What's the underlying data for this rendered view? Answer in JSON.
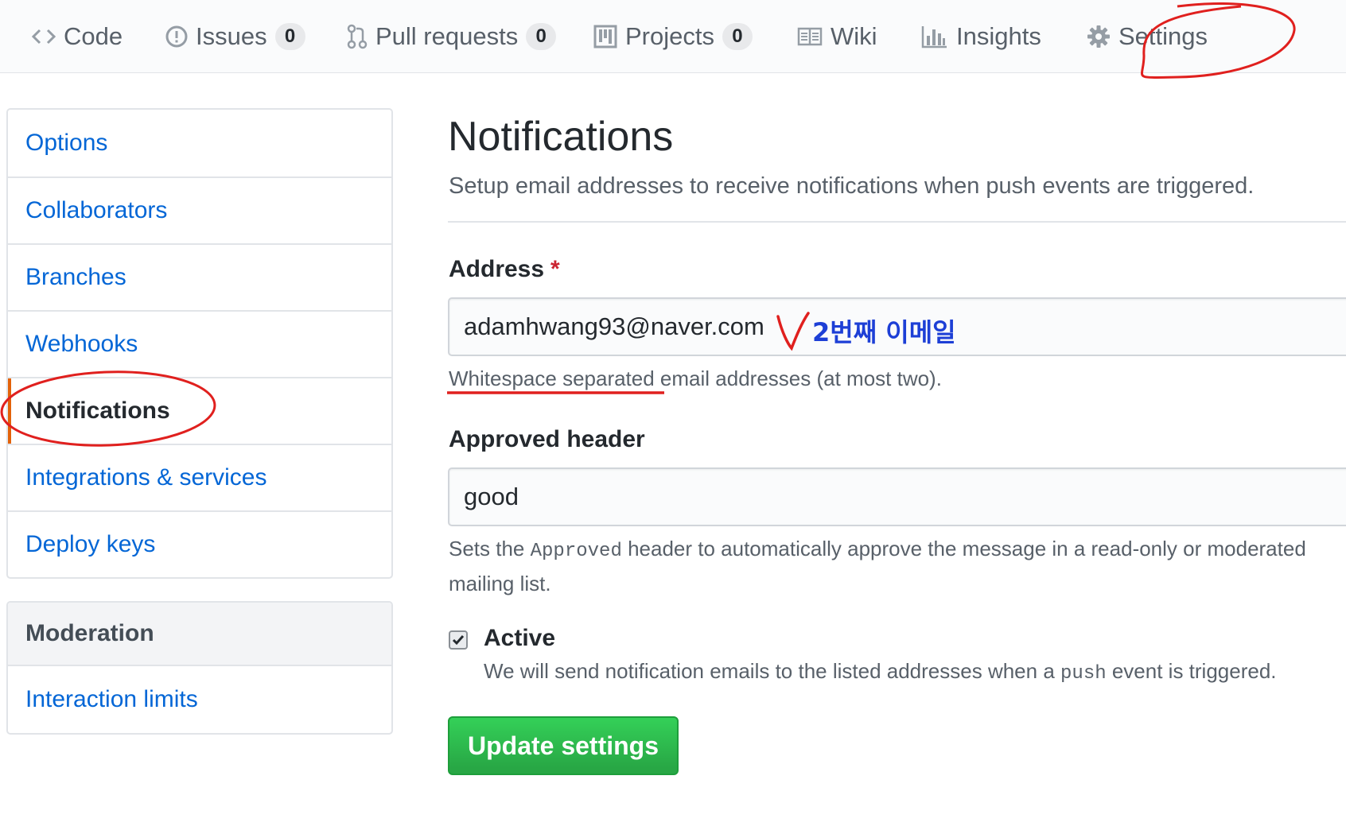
{
  "tabs": [
    {
      "label": "Code",
      "icon": "code-icon"
    },
    {
      "label": "Issues",
      "icon": "issue-icon",
      "count": "0"
    },
    {
      "label": "Pull requests",
      "icon": "pull-request-icon",
      "count": "0"
    },
    {
      "label": "Projects",
      "icon": "project-icon",
      "count": "0"
    },
    {
      "label": "Wiki",
      "icon": "book-icon"
    },
    {
      "label": "Insights",
      "icon": "graph-icon"
    },
    {
      "label": "Settings",
      "icon": "gear-icon"
    }
  ],
  "sidebar": {
    "items": [
      {
        "label": "Options"
      },
      {
        "label": "Collaborators"
      },
      {
        "label": "Branches"
      },
      {
        "label": "Webhooks"
      },
      {
        "label": "Notifications",
        "selected": true
      },
      {
        "label": "Integrations & services"
      },
      {
        "label": "Deploy keys"
      }
    ],
    "moderation": {
      "heading": "Moderation",
      "items": [
        {
          "label": "Interaction limits"
        }
      ]
    }
  },
  "main": {
    "title": "Notifications",
    "subtitle": "Setup email addresses to receive notifications when push events are triggered.",
    "address": {
      "label": "Address",
      "required_mark": "*",
      "value": "adamhwang93@naver.com",
      "note": "Whitespace separated email addresses (at most two)."
    },
    "approved_header": {
      "label": "Approved header",
      "value": "good",
      "note_before": "Sets the ",
      "note_code": "Approved",
      "note_after": " header to automatically approve the message in a read-only or moderated mailing list."
    },
    "active": {
      "label": "Active",
      "checked": true,
      "note_before": "We will send notification emails to the listed addresses when a ",
      "note_code": "push",
      "note_after": " event is triggered."
    },
    "submit_label": "Update settings"
  },
  "annotation": {
    "text": "2번째 이메일",
    "color": "#e0201e"
  },
  "colors": {
    "link": "#0366d6",
    "selected_accent": "#e36209",
    "button_green": "#28a745",
    "annotation_blue": "#1d3fd6"
  }
}
